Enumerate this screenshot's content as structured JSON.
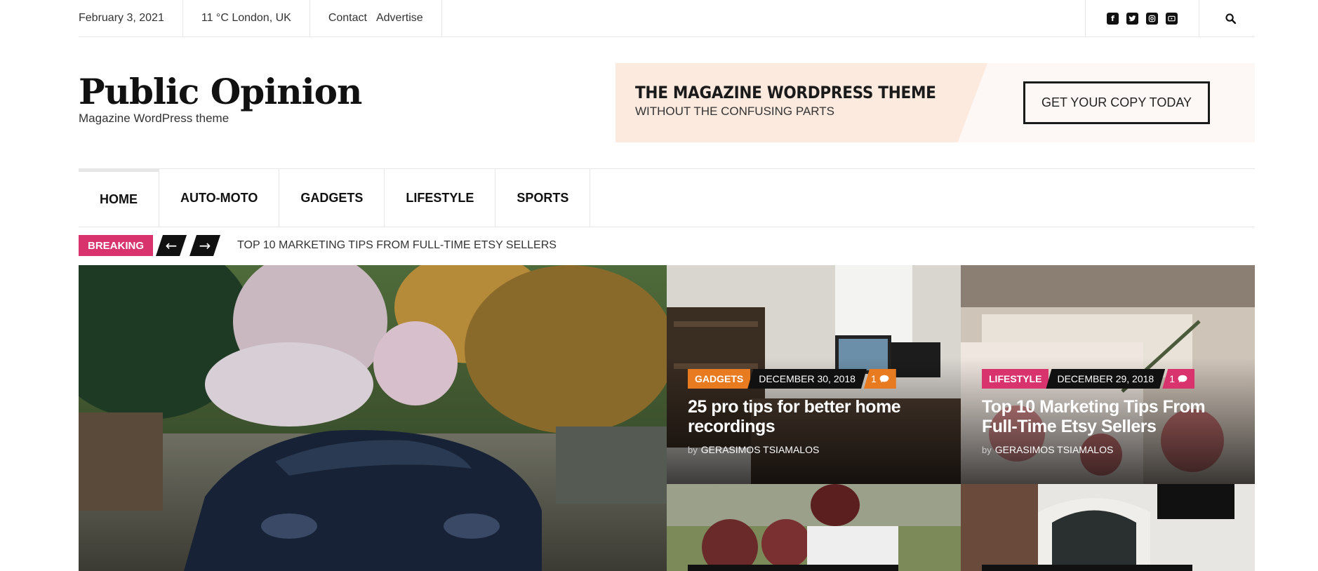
{
  "topbar": {
    "date": "February 3, 2021",
    "weather": "11 °C London, UK",
    "links": [
      "Contact",
      "Advertise"
    ],
    "social_icons": [
      "facebook-icon",
      "twitter-icon",
      "instagram-icon",
      "youtube-icon"
    ],
    "search_icon": "search-icon"
  },
  "header": {
    "logo_title": "Public Opinion",
    "tagline": "Magazine WordPress theme"
  },
  "banner": {
    "heading": "THE MAGAZINE WORDPRESS THEME",
    "subheading": "WITHOUT THE CONFUSING PARTS",
    "button": "GET YOUR COPY TODAY"
  },
  "nav": {
    "items": [
      "HOME",
      "AUTO-MOTO",
      "GADGETS",
      "LIFESTYLE",
      "SPORTS"
    ],
    "active": "HOME"
  },
  "breaking": {
    "label": "BREAKING",
    "prev_icon": "arrow-left-icon",
    "next_icon": "arrow-right-icon",
    "headline": "TOP 10 MARKETING TIPS FROM FULL-TIME ETSY SELLERS"
  },
  "posts": [
    {
      "category": "GADGETS",
      "category_color": "#e87a1f",
      "date": "DECEMBER 30, 2018",
      "comments": "1",
      "title": "25 pro tips for better home recordings",
      "by": "by",
      "author": "GERASIMOS TSIAMALOS"
    },
    {
      "category": "LIFESTYLE",
      "category_color": "#d8336d",
      "date": "DECEMBER 29, 2018",
      "comments": "1",
      "title": "Top 10 Marketing Tips From Full-Time Etsy Sellers",
      "by": "by",
      "author": "GERASIMOS TSIAMALOS"
    }
  ],
  "colors": {
    "accent_pink": "#d8336d",
    "accent_orange": "#e87a1f",
    "dark": "#111111"
  }
}
